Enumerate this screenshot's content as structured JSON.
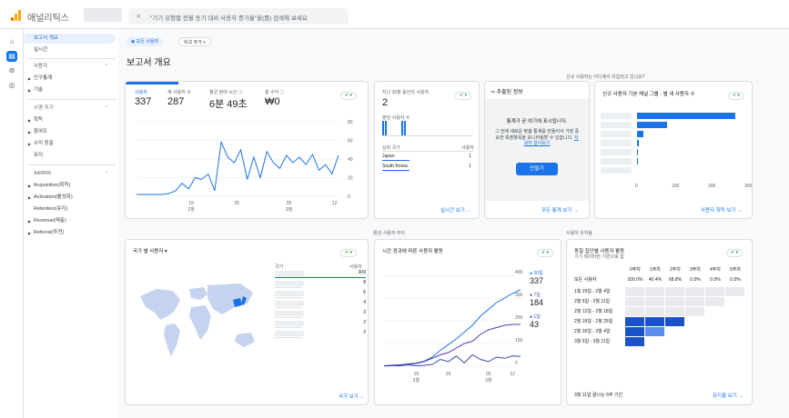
{
  "header": {
    "app_title": "애널리틱스",
    "search_placeholder": "\"기기 유형별 전월 동기 대비 사용자 증가율\"을(를) 검색해 보세요"
  },
  "colors": {
    "accent": "#1a73e8",
    "logo_orange": "#f9ab00",
    "logo_dark": "#e37400"
  },
  "rail": [
    "home-icon",
    "reports-icon",
    "explore-icon",
    "advertising-icon"
  ],
  "sidebar": {
    "items": [
      {
        "label": "보고서 개요"
      },
      {
        "label": "실시간"
      },
      {
        "label": "사용자"
      },
      {
        "label": "인구통계"
      },
      {
        "label": "기술"
      },
      {
        "label": "수명 주기"
      },
      {
        "label": "획득"
      },
      {
        "label": "참여도"
      },
      {
        "label": "수익 창출"
      },
      {
        "label": "유지"
      },
      {
        "label": "AARRR"
      },
      {
        "label": "Acquisition(획득)"
      },
      {
        "label": "Activation(활성화)"
      },
      {
        "label": "Retention(유지)"
      },
      {
        "label": "Revenue(매출)"
      },
      {
        "label": "Referral(추천)"
      }
    ]
  },
  "main": {
    "chips": {
      "all_users": "모든 사용자",
      "add_comparison": "비교 추가 +"
    },
    "title": "보고서 개요",
    "question_label": "신규 사용자는 어디에서 유입되고 있나요?",
    "section_realtime": "활성 사용자 추이",
    "section_retention": "사용자 유지율"
  },
  "overview": {
    "metrics": [
      {
        "label": "사용자",
        "value": "337"
      },
      {
        "label": "새 사용자 수",
        "value": "287"
      },
      {
        "label": "평균 참여 시간 ⓘ",
        "value": "6분 49초"
      },
      {
        "label": "총 수익 ⓘ",
        "value": "₩0"
      }
    ],
    "x_ticks": [
      "19\n2월",
      "26",
      "05\n3월",
      "12"
    ],
    "y_ticks": [
      "80",
      "60",
      "40",
      "20",
      "0"
    ],
    "series": [
      2,
      2,
      2,
      2,
      2,
      3,
      6,
      14,
      8,
      20,
      18,
      24,
      6,
      58,
      42,
      36,
      50,
      18,
      42,
      20,
      48,
      36,
      30,
      44,
      36,
      42,
      34,
      45,
      28,
      34,
      24,
      44
    ]
  },
  "realtime": {
    "title": "지난 30분 동안의 사용자",
    "value": "2",
    "sub": "분당 사용자 수",
    "col1": "상위 국가",
    "col2": "사용자",
    "rows": [
      {
        "name": "Japan",
        "value": "1"
      },
      {
        "name": "South Korea",
        "value": "1"
      }
    ],
    "link": "실시간 보기 →",
    "minute_bars": [
      1,
      1,
      0,
      0,
      0,
      0,
      0,
      1,
      1,
      0,
      0,
      0,
      0,
      0,
      0,
      0
    ]
  },
  "insights": {
    "title": "추출된 정보",
    "headline": "통계가 곧 여기에 표시됩니다.",
    "body": "그 전에 새로운 맞춤 통계를 만들어서 가장 중요한 측정항목을 모니터링할 수 있습니다.",
    "learn_more": "자세히 알아보기",
    "create": "만들기",
    "link": "모든 통계 보기 →"
  },
  "channel": {
    "title": "신규 사용자 기본 채널 그룹 - 별 새 사용자 수",
    "values": [
      270,
      82,
      18,
      4,
      2,
      1,
      0
    ],
    "x_ticks": [
      "0",
      "100",
      "200",
      "300"
    ],
    "link": "사용자 획득 보기 →"
  },
  "country": {
    "title": "국가 별 사용자 ▾",
    "col1": "국가",
    "col2": "사용자",
    "values": [
      "309",
      "8",
      "6",
      "4",
      "3",
      "2",
      "2"
    ],
    "link": "국가 보기 →"
  },
  "active": {
    "title": "시간 경과에 따른 사용자 활동",
    "legend": [
      {
        "label": "● 30일",
        "value": "337",
        "color": "#1a73e8"
      },
      {
        "label": "● 7일",
        "value": "184",
        "color": "#5e35b1"
      },
      {
        "label": "● 1일",
        "value": "43",
        "color": "#3949ab"
      }
    ],
    "y_ticks": [
      "400",
      "300",
      "200",
      "100",
      "0"
    ],
    "x_ticks": [
      "19\n2월",
      "26",
      "05\n3월",
      "12"
    ],
    "series30": [
      2,
      4,
      6,
      10,
      14,
      22,
      40,
      70,
      95,
      120,
      150,
      180,
      220,
      250,
      280,
      300,
      320,
      337
    ],
    "series7": [
      2,
      4,
      6,
      8,
      12,
      20,
      35,
      50,
      60,
      80,
      100,
      110,
      140,
      160,
      170,
      180,
      184,
      184
    ],
    "series1": [
      1,
      2,
      2,
      6,
      2,
      4,
      8,
      30,
      20,
      45,
      15,
      50,
      30,
      20,
      40,
      35,
      45,
      43
    ]
  },
  "cohort": {
    "title": "동질 집단별 사용자 활동",
    "subtitle": "기기 데이터만 기반으로 함",
    "weeks": [
      "0주차",
      "1주차",
      "2주차",
      "3주차",
      "4주차",
      "5주차"
    ],
    "all_label": "모든 사용자",
    "all_values": [
      "100.0%",
      "40.4%",
      "68.8%",
      "0.0%",
      "0.0%",
      "0.0%"
    ],
    "rows": [
      "1월 29일 - 2월 4일",
      "2월 5일 - 2월 11일",
      "2월 12일 - 2월 18일",
      "2월 19일 - 2월 25일",
      "2월 26일 - 3월 4일",
      "3월 5일 - 3월 11일"
    ],
    "footer": "3월 11일 끝나는 6주 기간",
    "link": "유지율 보기 →"
  }
}
